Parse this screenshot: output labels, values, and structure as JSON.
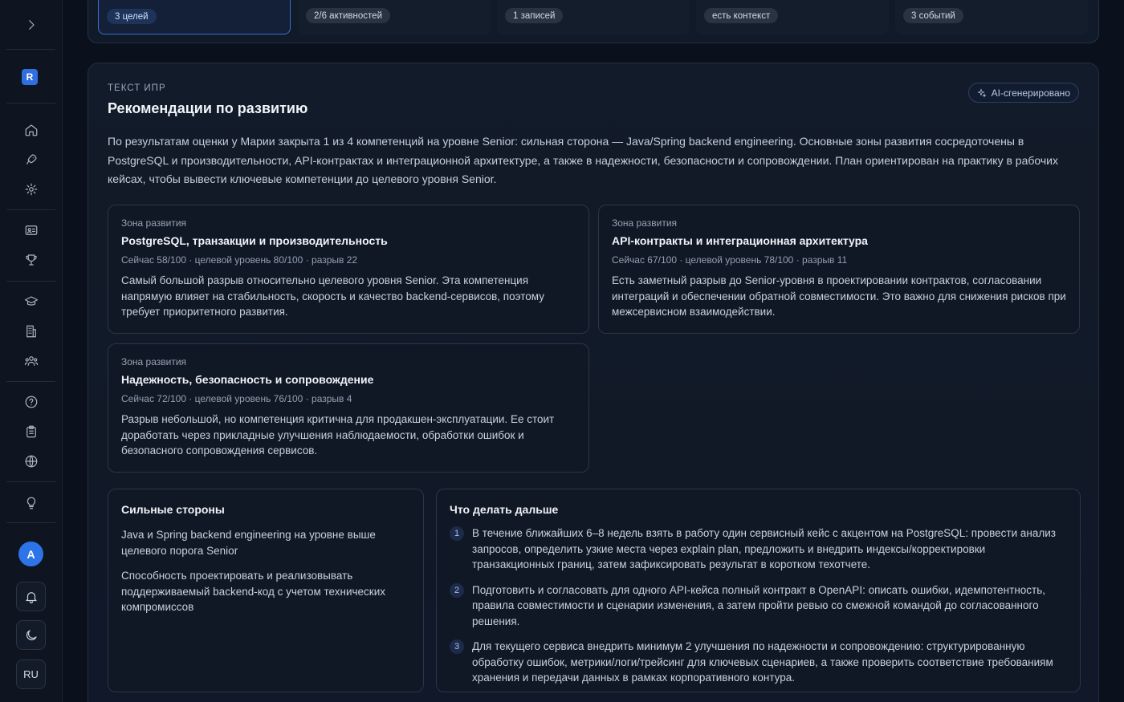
{
  "sidebar": {
    "workspace_initial": "R",
    "nav_icons": [
      "chevron-right-icon",
      "home-icon",
      "rocket-icon",
      "settings-icon",
      "id-card-icon",
      "trophy-icon",
      "graduation-cap-icon",
      "building-icon",
      "users-icon",
      "help-icon",
      "clipboard-icon",
      "globe-icon",
      "lightbulb-icon"
    ],
    "avatar_initial": "A",
    "language": "RU"
  },
  "top_tiles": [
    {
      "label": "3 целей",
      "active": true
    },
    {
      "label": "2/6 активностей",
      "active": false
    },
    {
      "label": "1 записей",
      "active": false
    },
    {
      "label": "есть контекст",
      "active": false
    },
    {
      "label": "3 событий",
      "active": false
    }
  ],
  "main": {
    "eyebrow": "ТЕКСТ ИПР",
    "title": "Рекомендации по развитию",
    "ai_badge": "AI-сгенерировано",
    "intro": "По результатам оценки у Марии закрыта 1 из 4 компетенций на уровне Senior: сильная сторона — Java/Spring backend engineering. Основные зоны развития сосредоточены в PostgreSQL и производительности, API-контрактах и интеграционной архитектуре, а также в надежности, безопасности и сопровождении. План ориентирован на практику в рабочих кейсах, чтобы вывести ключевые компетенции до целевого уровня Senior.",
    "zones": [
      {
        "label": "Зона развития",
        "title": "PostgreSQL, транзакции и производительность",
        "meta": "Сейчас 58/100 · целевой уровень 80/100 · разрыв 22",
        "text": "Самый большой разрыв относительно целевого уровня Senior. Эта компетенция напрямую влияет на стабильность, скорость и качество backend-сервисов, поэтому требует приоритетного развития."
      },
      {
        "label": "Зона развития",
        "title": "API-контракты и интеграционная архитектура",
        "meta": "Сейчас 67/100 · целевой уровень 78/100 · разрыв 11",
        "text": "Есть заметный разрыв до Senior-уровня в проектировании контрактов, согласовании интеграций и обеспечении обратной совместимости. Это важно для снижения рисков при межсервисном взаимодействии."
      },
      {
        "label": "Зона развития",
        "title": "Надежность, безопасность и сопровождение",
        "meta": "Сейчас 72/100 · целевой уровень 76/100 · разрыв 4",
        "text": "Разрыв небольшой, но компетенция критична для продакшен-эксплуатации. Ее стоит доработать через прикладные улучшения наблюдаемости, обработки ошибок и безопасного сопровождения сервисов."
      }
    ],
    "strengths": {
      "title": "Сильные стороны",
      "items": [
        "Java и Spring backend engineering на уровне выше целевого порога Senior",
        "Способность проектировать и реализовывать поддерживаемый backend-код с учетом технических компромиссов"
      ]
    },
    "next_steps": {
      "title": "Что делать дальше",
      "items": [
        {
          "num": "1",
          "text": "В течение ближайших 6–8 недель взять в работу один сервисный кейс с акцентом на PostgreSQL: провести анализ запросов, определить узкие места через explain plan, предложить и внедрить индексы/корректировки транзакционных границ, затем зафиксировать результат в коротком техотчете."
        },
        {
          "num": "2",
          "text": "Подготовить и согласовать для одного API-кейса полный контракт в OpenAPI: описать ошибки, идемпотентность, правила совместимости и сценарии изменения, а затем пройти ревью со смежной командой до согласованного решения."
        },
        {
          "num": "3",
          "text": "Для текущего сервиса внедрить минимум 2 улучшения по надежности и сопровождению: структурированную обработку ошибок, метрики/логи/трейсинг для ключевых сценариев, а также проверить соответствие требованиям хранения и передачи данных в рамках корпоративного контура."
        }
      ]
    }
  }
}
